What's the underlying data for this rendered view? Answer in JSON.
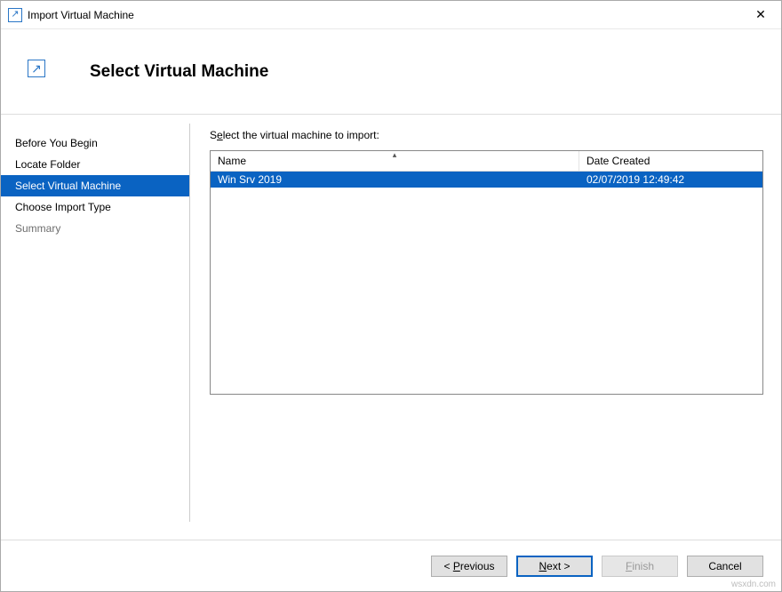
{
  "window": {
    "title": "Import Virtual Machine"
  },
  "header": {
    "title": "Select Virtual Machine"
  },
  "sidebar": {
    "steps": [
      {
        "label": "Before You Begin",
        "state": "normal"
      },
      {
        "label": "Locate Folder",
        "state": "normal"
      },
      {
        "label": "Select Virtual Machine",
        "state": "selected"
      },
      {
        "label": "Choose Import Type",
        "state": "normal"
      },
      {
        "label": "Summary",
        "state": "disabled"
      }
    ]
  },
  "content": {
    "instruction_pre": "S",
    "instruction_accel": "e",
    "instruction_post": "lect the virtual machine to import:",
    "columns": {
      "name": "Name",
      "date": "Date Created"
    },
    "rows": [
      {
        "name": "Win Srv 2019",
        "date": "02/07/2019 12:49:42",
        "selected": true
      }
    ]
  },
  "footer": {
    "previous_pre": "< ",
    "previous_accel": "P",
    "previous_post": "revious",
    "next_pre": "",
    "next_accel": "N",
    "next_post": "ext >",
    "finish_pre": "",
    "finish_accel": "F",
    "finish_post": "inish",
    "cancel": "Cancel",
    "finish_enabled": false
  },
  "watermark": "wsxdn.com"
}
